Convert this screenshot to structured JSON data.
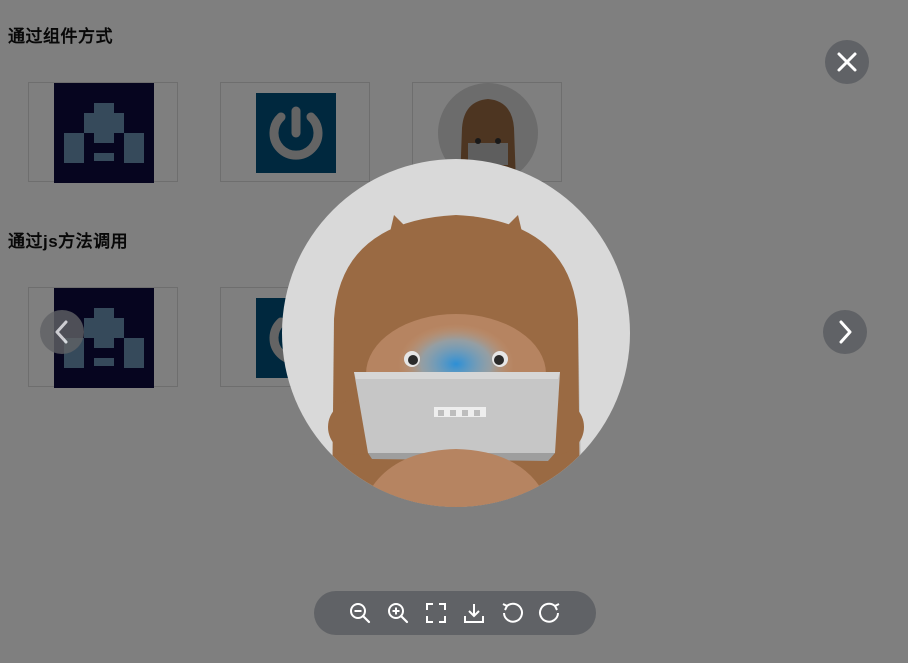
{
  "sections": {
    "component_title": "通过组件方式",
    "js_title": "通过js方法调用"
  },
  "thumbnails": [
    {
      "name": "identicon-pixel",
      "colors": {
        "bg": "#0d0a3e",
        "fg": "#6c95b6"
      }
    },
    {
      "name": "power-logo",
      "colors": {
        "bg": "#00507d",
        "fg": "#c9c9c9"
      }
    },
    {
      "name": "squirrel-avatar",
      "colors": {
        "bg": "#d9d9d9",
        "fg": "#9a6a43"
      }
    }
  ],
  "viewer": {
    "close_icon": "close-icon",
    "prev_icon": "chevron-left-icon",
    "next_icon": "chevron-right-icon",
    "toolbar_icons": [
      "zoom-out-icon",
      "zoom-in-icon",
      "fullscreen-icon",
      "download-icon",
      "rotate-left-icon",
      "rotate-right-icon"
    ],
    "laptop_text": "npm"
  },
  "colors": {
    "mask": "rgba(0,0,0,0.5)",
    "control_bg": "#606266",
    "control_fg": "#ffffff"
  }
}
